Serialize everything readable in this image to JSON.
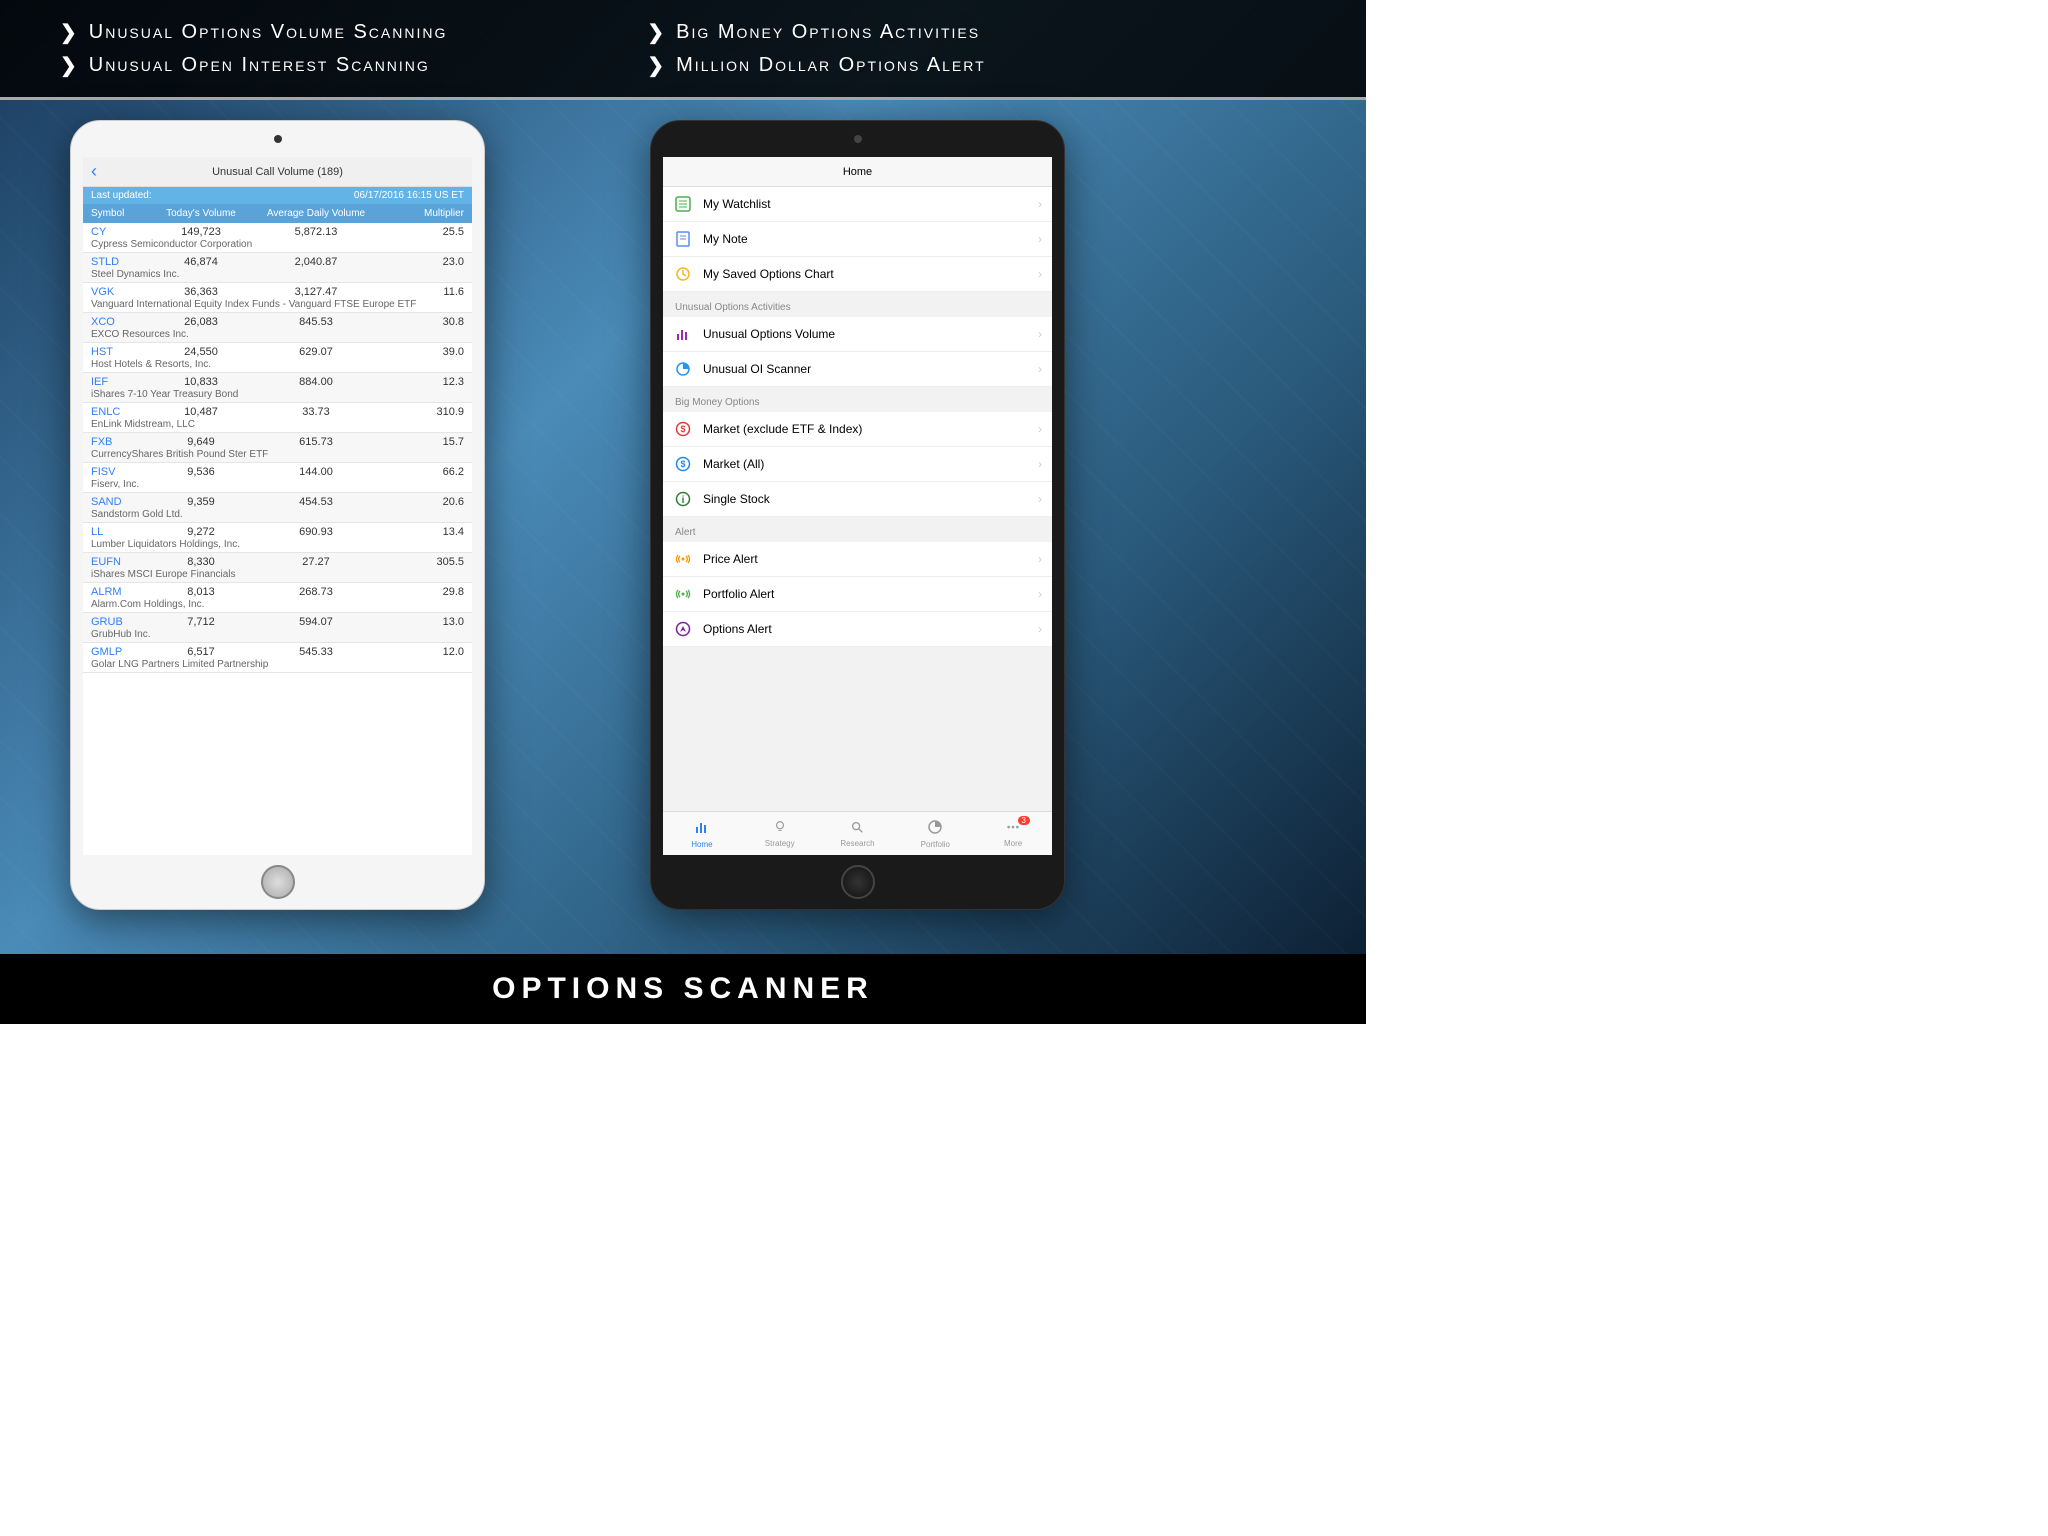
{
  "banner": {
    "left": [
      "Unusual Options Volume Scanning",
      "Unusual Open Interest Scanning"
    ],
    "right": [
      "Big Money Options Activities",
      "Million Dollar Options Alert"
    ]
  },
  "footer": "OPTIONS SCANNER",
  "leftScreen": {
    "title": "Unusual Call Volume  (189)",
    "lastUpdatedLabel": "Last updated:",
    "lastUpdatedValue": "06/17/2016  16:15 US ET",
    "headers": [
      "Symbol",
      "Today's Volume",
      "Average Daily Volume",
      "Multiplier"
    ],
    "rows": [
      {
        "sym": "CY",
        "v1": "149,723",
        "v2": "5,872.13",
        "v3": "25.5",
        "name": "Cypress Semiconductor Corporation"
      },
      {
        "sym": "STLD",
        "v1": "46,874",
        "v2": "2,040.87",
        "v3": "23.0",
        "name": "Steel Dynamics Inc."
      },
      {
        "sym": "VGK",
        "v1": "36,363",
        "v2": "3,127.47",
        "v3": "11.6",
        "name": "Vanguard International Equity Index Funds - Vanguard FTSE Europe ETF"
      },
      {
        "sym": "XCO",
        "v1": "26,083",
        "v2": "845.53",
        "v3": "30.8",
        "name": "EXCO Resources Inc."
      },
      {
        "sym": "HST",
        "v1": "24,550",
        "v2": "629.07",
        "v3": "39.0",
        "name": "Host Hotels & Resorts, Inc."
      },
      {
        "sym": "IEF",
        "v1": "10,833",
        "v2": "884.00",
        "v3": "12.3",
        "name": "iShares 7-10 Year Treasury Bond"
      },
      {
        "sym": "ENLC",
        "v1": "10,487",
        "v2": "33.73",
        "v3": "310.9",
        "name": "EnLink Midstream, LLC"
      },
      {
        "sym": "FXB",
        "v1": "9,649",
        "v2": "615.73",
        "v3": "15.7",
        "name": "CurrencyShares British Pound Ster ETF"
      },
      {
        "sym": "FISV",
        "v1": "9,536",
        "v2": "144.00",
        "v3": "66.2",
        "name": "Fiserv, Inc."
      },
      {
        "sym": "SAND",
        "v1": "9,359",
        "v2": "454.53",
        "v3": "20.6",
        "name": "Sandstorm Gold Ltd."
      },
      {
        "sym": "LL",
        "v1": "9,272",
        "v2": "690.93",
        "v3": "13.4",
        "name": "Lumber Liquidators Holdings, Inc."
      },
      {
        "sym": "EUFN",
        "v1": "8,330",
        "v2": "27.27",
        "v3": "305.5",
        "name": "iShares MSCI Europe Financials"
      },
      {
        "sym": "ALRM",
        "v1": "8,013",
        "v2": "268.73",
        "v3": "29.8",
        "name": "Alarm.Com Holdings, Inc."
      },
      {
        "sym": "GRUB",
        "v1": "7,712",
        "v2": "594.07",
        "v3": "13.0",
        "name": "GrubHub Inc."
      },
      {
        "sym": "GMLP",
        "v1": "6,517",
        "v2": "545.33",
        "v3": "12.0",
        "name": "Golar LNG Partners Limited Partnership"
      }
    ]
  },
  "rightScreen": {
    "title": "Home",
    "groups": [
      {
        "header": null,
        "items": [
          {
            "icon": "list",
            "color": "#4caf50",
            "label": "My Watchlist"
          },
          {
            "icon": "note",
            "color": "#5b8def",
            "label": "My Note"
          },
          {
            "icon": "clock",
            "color": "#f5b915",
            "label": "My Saved Options Chart"
          }
        ]
      },
      {
        "header": "Unusual Options Activities",
        "items": [
          {
            "icon": "bars",
            "color": "#9c27b0",
            "label": "Unusual Options Volume"
          },
          {
            "icon": "pie",
            "color": "#2196f3",
            "label": "Unusual OI Scanner"
          }
        ]
      },
      {
        "header": "Big Money Options",
        "items": [
          {
            "icon": "dollar",
            "color": "#e53935",
            "label": "Market (exclude ETF & Index)"
          },
          {
            "icon": "dollar",
            "color": "#1e88e5",
            "label": "Market (All)"
          },
          {
            "icon": "info",
            "color": "#2e7d32",
            "label": "Single Stock"
          }
        ]
      },
      {
        "header": "Alert",
        "items": [
          {
            "icon": "signal",
            "color": "#ff9800",
            "label": "Price Alert"
          },
          {
            "icon": "signal",
            "color": "#4caf50",
            "label": "Portfolio Alert"
          },
          {
            "icon": "compass",
            "color": "#7b1fa2",
            "label": "Options Alert"
          }
        ]
      }
    ],
    "tabs": [
      {
        "label": "Home",
        "active": true,
        "icon": "bars"
      },
      {
        "label": "Strategy",
        "active": false,
        "icon": "bulb"
      },
      {
        "label": "Research",
        "active": false,
        "icon": "search"
      },
      {
        "label": "Portfolio",
        "active": false,
        "icon": "pie"
      },
      {
        "label": "More",
        "active": false,
        "icon": "dots",
        "badge": "3"
      }
    ]
  }
}
